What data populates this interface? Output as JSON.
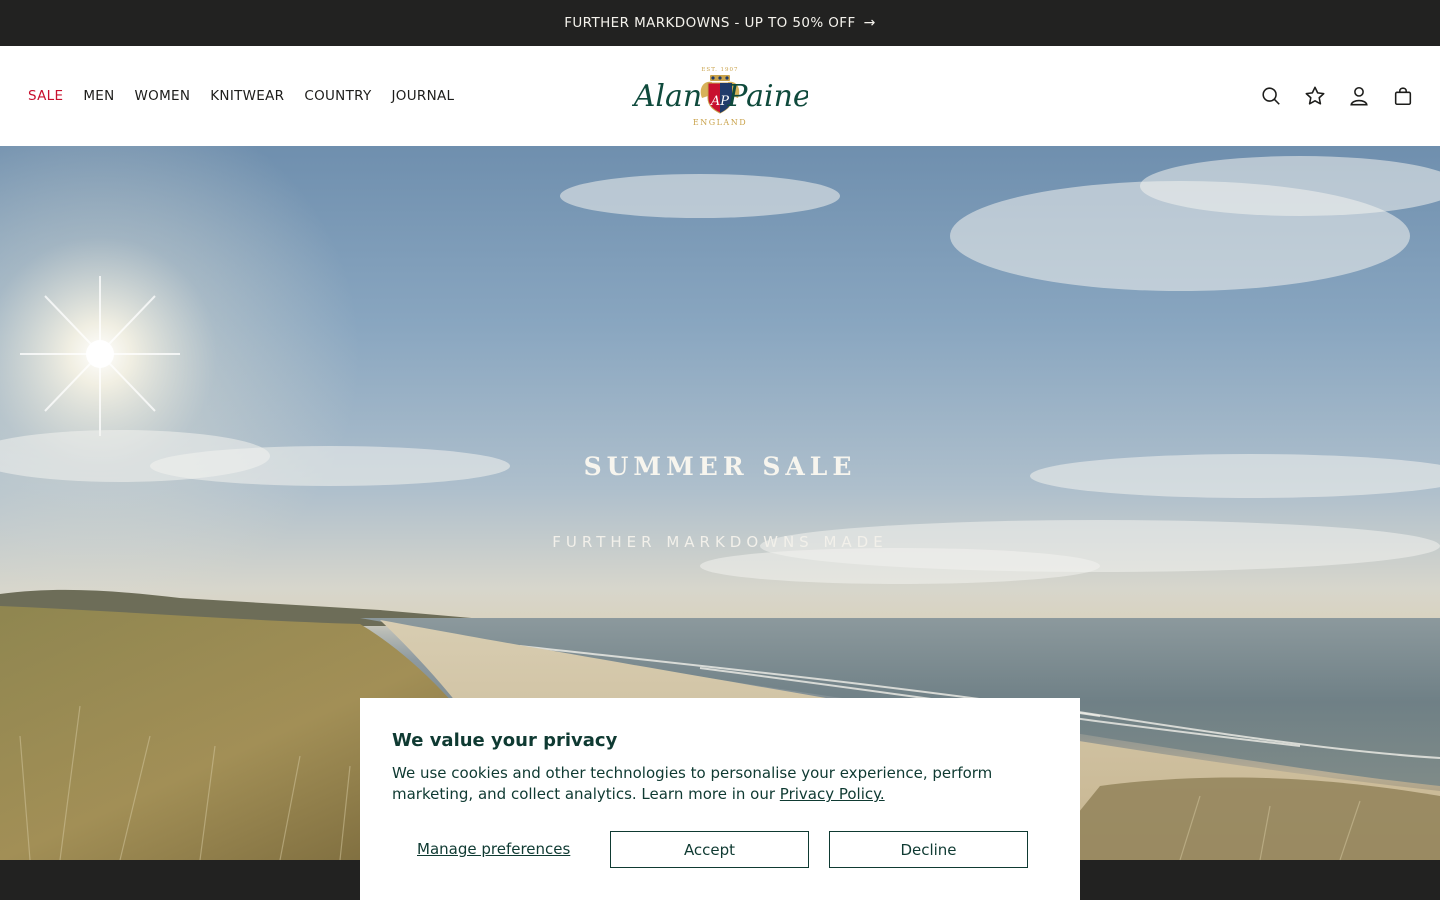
{
  "announcement": {
    "text": "FURTHER MARKDOWNS - UP TO 50% OFF",
    "arrow_icon": "arrow-right-icon"
  },
  "header": {
    "nav": [
      {
        "label": "SALE",
        "color": "#c8102e"
      },
      {
        "label": "MEN"
      },
      {
        "label": "WOMEN"
      },
      {
        "label": "KNITWEAR"
      },
      {
        "label": "COUNTRY"
      },
      {
        "label": "JOURNAL"
      }
    ],
    "logo": {
      "wordmark_left": "Alan",
      "wordmark_right": "Paine",
      "est": "EST. 1907",
      "country": "ENGLAND",
      "monogram": "AP",
      "brand_color": "#0f4a3c",
      "gold": "#c9a24a"
    },
    "icons": [
      "search-icon",
      "star-icon",
      "account-icon",
      "bag-icon"
    ]
  },
  "hero": {
    "title": "SUMMER SALE",
    "subtitle": "FURTHER MARKDOWNS MADE"
  },
  "cookie_banner": {
    "title": "We value your privacy",
    "body": "We use cookies and other technologies to personalise your experience, perform marketing, and collect analytics. Learn more in our ",
    "link": "Privacy Policy.",
    "manage_label": "Manage preferences",
    "accept_label": "Accept",
    "decline_label": "Decline",
    "text_color": "#0f3a32"
  }
}
